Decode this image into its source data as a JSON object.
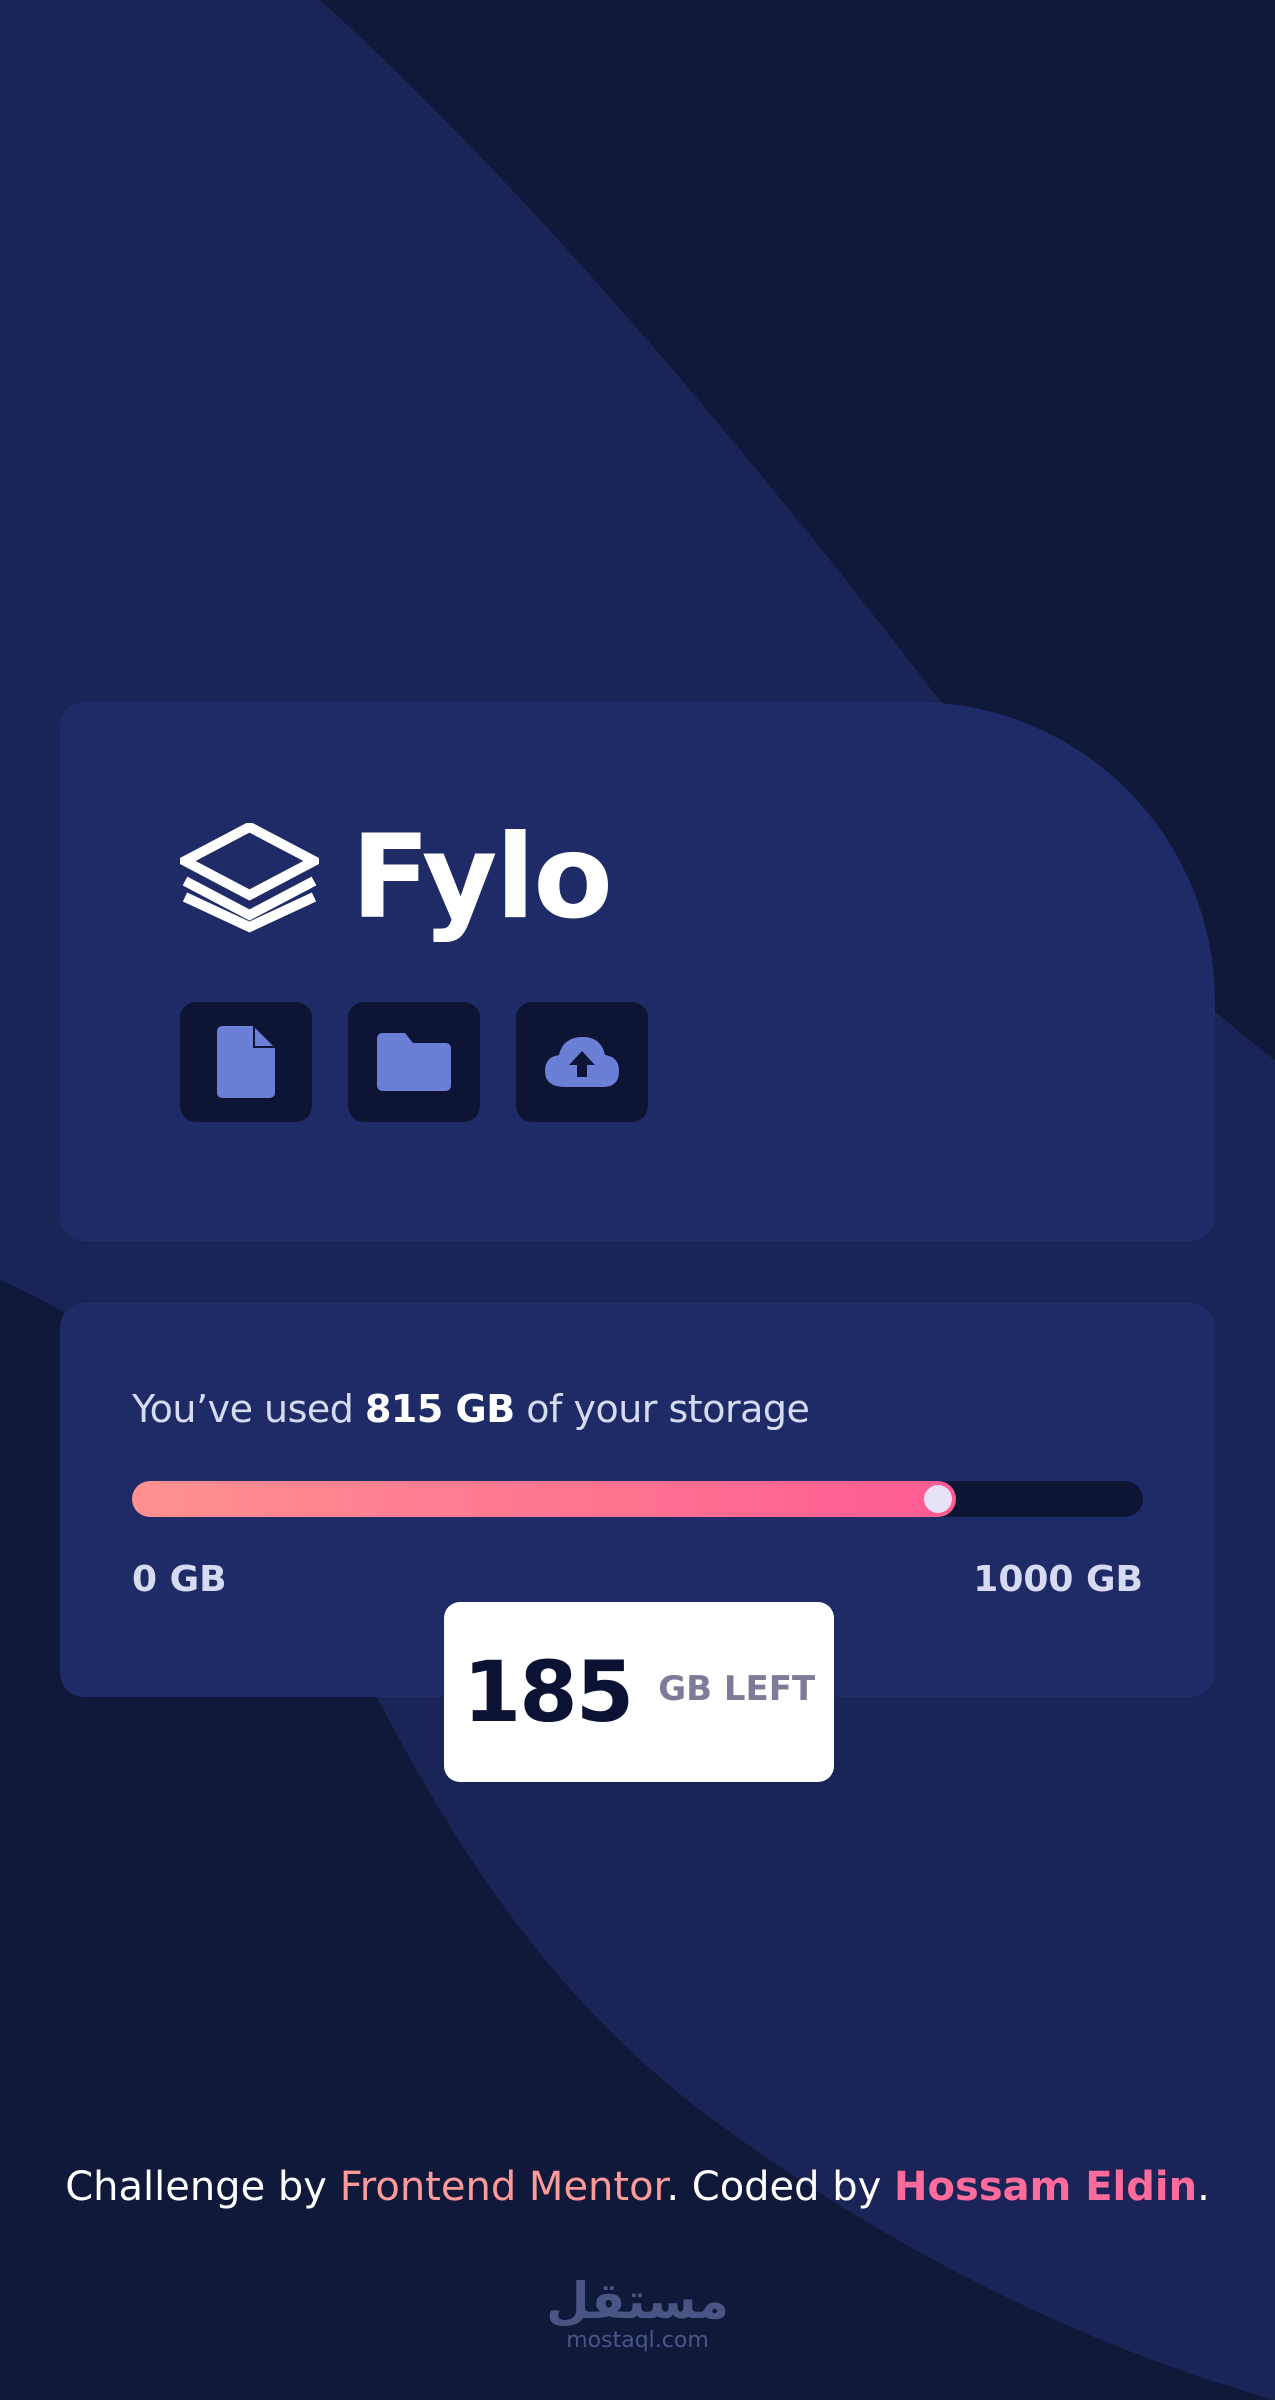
{
  "colors": {
    "background": "#10193a",
    "card": "#1f2b66",
    "icon_button": "#0e1534",
    "icon_fill": "#6c7fd6",
    "bar_start": "#ff9190",
    "bar_end": "#ff5c92",
    "accent_link": "#ff9a9a",
    "accent_author": "#ff6b9a"
  },
  "brand": {
    "name": "Fylo",
    "mark_icon": "stacked-layers-icon"
  },
  "actions": [
    {
      "id": "document",
      "icon": "document-icon"
    },
    {
      "id": "folder",
      "icon": "folder-icon"
    },
    {
      "id": "upload",
      "icon": "cloud-upload-icon"
    }
  ],
  "usage": {
    "prefix": "You’ve used ",
    "amount": "815 GB",
    "suffix": " of your storage",
    "used_fraction": 0.815,
    "min_label": "0 GB",
    "max_label": "1000 GB"
  },
  "remaining": {
    "value": "185",
    "unit": "GB LEFT"
  },
  "footer": {
    "lead": "Challenge by ",
    "fm_link": "Frontend Mentor",
    "mid": ". Coded by ",
    "author": "Hossam Eldin",
    "end": "."
  },
  "watermark": {
    "logo_text": "مستقل",
    "url": "mostaql.com"
  }
}
